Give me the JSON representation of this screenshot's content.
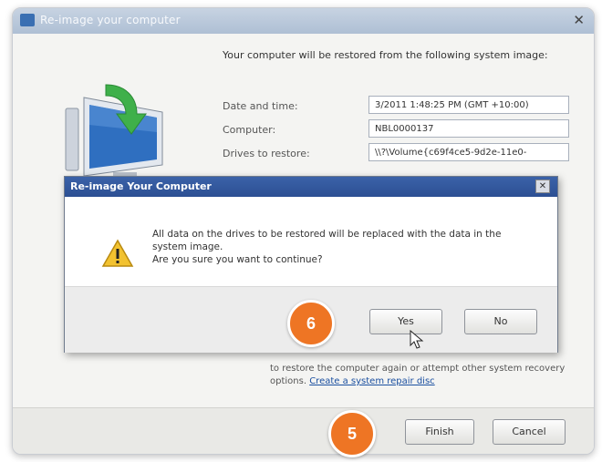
{
  "window": {
    "title": "Re-image your computer",
    "intro": "Your computer will be restored from the following system image:",
    "fields": [
      {
        "label": "Date and time:",
        "value": "3/2011 1:48:25 PM (GMT +10:00)"
      },
      {
        "label": "Computer:",
        "value": "NBL0000137"
      },
      {
        "label": "Drives to restore:",
        "value": "\\\\?\\Volume{c69f4ce5-9d2e-11e0-"
      }
    ],
    "below_text": "to restore the computer again or attempt other system recovery options.",
    "below_link": "Create a system repair disc",
    "finish_label": "Finish",
    "cancel_label": "Cancel"
  },
  "dialog": {
    "title": "Re-image Your Computer",
    "message_line1": "All data on the drives to be restored will be replaced with the data in the system image.",
    "message_line2": "Are you sure you want to continue?",
    "yes_label": "Yes",
    "no_label": "No"
  },
  "callouts": {
    "step6": "6",
    "step5": "5",
    "color": "#ee7524"
  },
  "icons": [
    "computer-monitor-icon",
    "warning-icon",
    "close-icon",
    "mouse-cursor-icon"
  ]
}
